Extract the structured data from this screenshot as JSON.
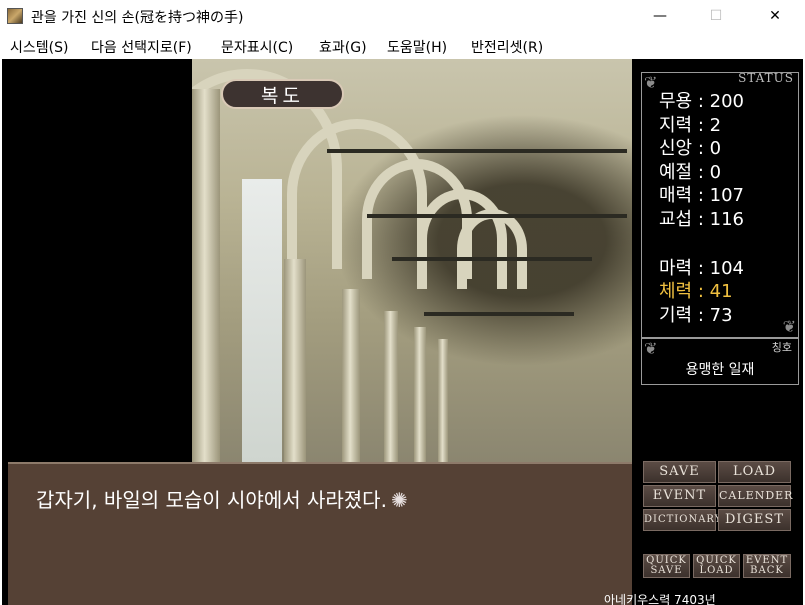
{
  "window": {
    "title": "관을 가진 신의 손(冠を持つ神の手)",
    "minimize_glyph": "—",
    "maximize_glyph": "☐",
    "close_glyph": "✕"
  },
  "menu": [
    {
      "label": "시스템(S)"
    },
    {
      "label": "다음 선택지로(F)"
    },
    {
      "label": "문자표시(C)"
    },
    {
      "label": "효과(G)"
    },
    {
      "label": "도움말(H)"
    },
    {
      "label": "반전리셋(R)"
    }
  ],
  "location": "복도",
  "status": {
    "title": "STATUS",
    "stats": [
      {
        "label": "무용 : 200"
      },
      {
        "label": "지력 : 2"
      },
      {
        "label": "신앙 : 0"
      },
      {
        "label": "예절 : 0"
      },
      {
        "label": "매력 : 107"
      },
      {
        "label": "교섭 : 116"
      },
      {
        "label": "마력 : 104"
      },
      {
        "label": "체력 : 41"
      },
      {
        "label": "기력 : 73"
      }
    ],
    "highlight_color": "#f0c040"
  },
  "rank": {
    "title": "칭호",
    "value": "용맹한 일재"
  },
  "dialog": {
    "text": "갑자기, 바일의 모습이 시야에서 사라졌다.",
    "cursor_glyph": "✺"
  },
  "buttons": {
    "save": "SAVE",
    "load": "LOAD",
    "event": "EVENT",
    "calender": "CALENDER",
    "dictionary": "DICTIONARY",
    "digest": "DIGEST",
    "quick_save_1": "QUICK",
    "quick_save_2": "SAVE",
    "quick_load_1": "QUICK",
    "quick_load_2": "LOAD",
    "event_back_1": "EVENT",
    "event_back_2": "BACK"
  },
  "footer": {
    "date": "아네키우스력 7403년"
  }
}
